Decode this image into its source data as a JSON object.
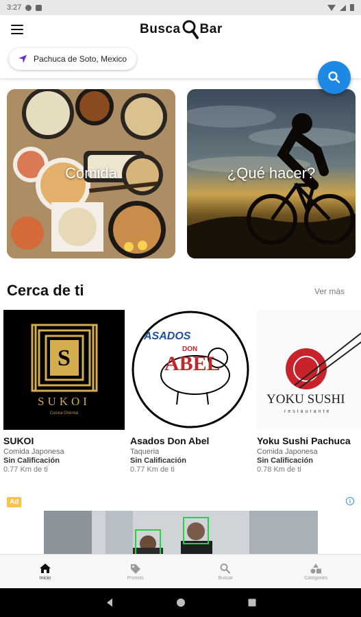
{
  "status_bar": {
    "time": "3:27",
    "icons": [
      "gear-icon",
      "sd-card-icon",
      "wifi-icon",
      "signal-icon",
      "battery-icon"
    ]
  },
  "header": {
    "logo_left": "Busca",
    "logo_right": "Bar",
    "menu_icon": "hamburger-menu-icon"
  },
  "location": {
    "label": "Pachuca de Soto, Mexico",
    "icon": "navigation-arrow-icon"
  },
  "search_fab": {
    "icon": "search-icon",
    "color": "#1e88e5"
  },
  "categories": [
    {
      "label": "Comida"
    },
    {
      "label": "¿Qué hacer?"
    }
  ],
  "nearby": {
    "title": "Cerca de ti",
    "see_more": "Ver más",
    "places": [
      {
        "name": "SUKOI",
        "logo_text": "SUKOI",
        "logo_sub": "Cocina Oriental",
        "category": "Comida Japonesa",
        "rating": "Sin Calificación",
        "distance": "0.77 Km de ti"
      },
      {
        "name": "Asados Don Abel",
        "logo_top": "ASADOS",
        "logo_mid": "DON",
        "logo_main": "ABEL",
        "category": "Taqueria",
        "rating": "Sin Calificación",
        "distance": "0.77 Km de ti"
      },
      {
        "name": "Yoku Sushi Pachuca",
        "logo_text": "YOKU SUSHI",
        "logo_sub": "restaurante",
        "category": "Comida Japonesa",
        "rating": "Sin Calificación",
        "distance": "0.78 Km de ti"
      }
    ]
  },
  "ad": {
    "badge": "Ad",
    "info_icon": "info-icon"
  },
  "bottom_nav": [
    {
      "label": "Inicio",
      "icon": "home-icon",
      "active": true
    },
    {
      "label": "Promos",
      "icon": "tag-icon",
      "active": false
    },
    {
      "label": "Buscar",
      "icon": "search-icon",
      "active": false
    },
    {
      "label": "Categories",
      "icon": "categories-icon",
      "active": false
    }
  ],
  "system_nav": [
    "back-icon",
    "home-circle-icon",
    "recents-icon"
  ]
}
